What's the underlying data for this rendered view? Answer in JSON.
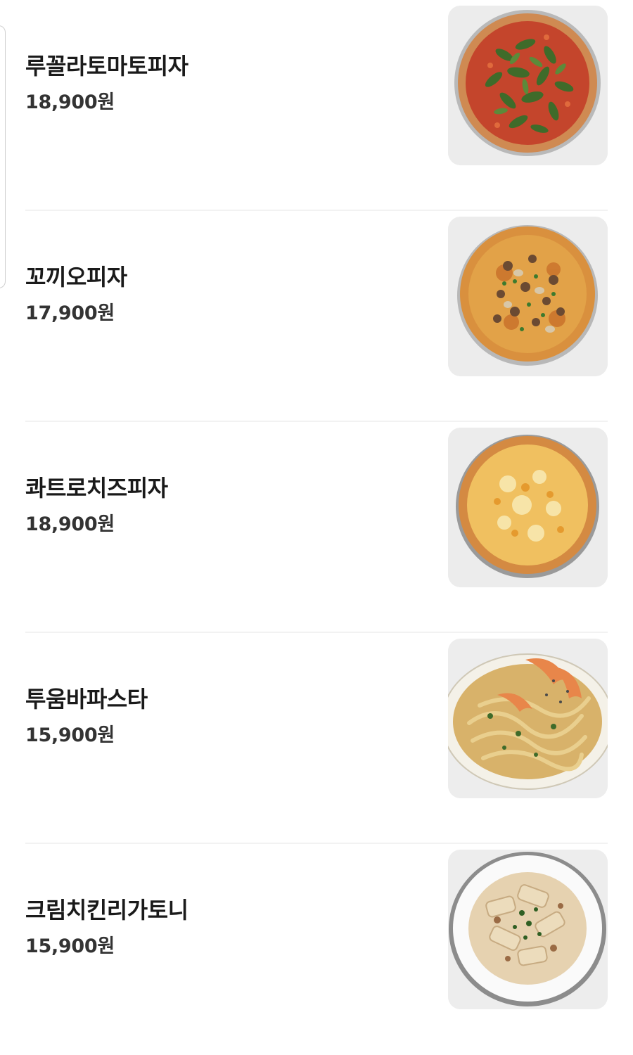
{
  "menu": {
    "items": [
      {
        "name": "루꼴라토마토피자",
        "price": "18,900원",
        "image": "arugula-tomato-pizza-photo"
      },
      {
        "name": "꼬끼오피자",
        "price": "17,900원",
        "image": "chicken-mushroom-pizza-photo"
      },
      {
        "name": "콰트로치즈피자",
        "price": "18,900원",
        "image": "four-cheese-pizza-photo"
      },
      {
        "name": "투움바파스타",
        "price": "15,900원",
        "image": "shrimp-toowoomba-pasta-photo"
      },
      {
        "name": "크림치킨리가토니",
        "price": "15,900원",
        "image": "cream-chicken-rigatoni-photo"
      }
    ]
  },
  "colors": {
    "text": "#1a1a1a",
    "price": "#333333",
    "divider": "#f2f2f2",
    "thumb_bg": "#ececec"
  }
}
